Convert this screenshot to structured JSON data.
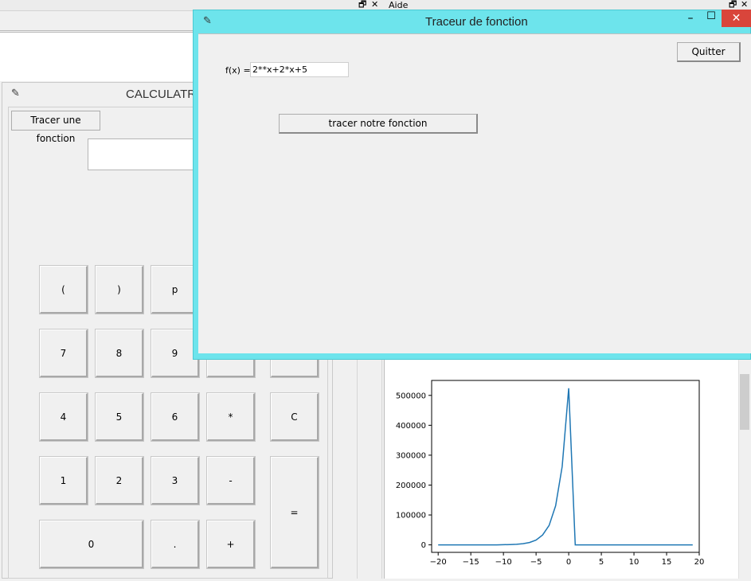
{
  "background_window": {
    "menu_label": "Aide",
    "restore_glyph": "🗗",
    "close_glyph": "✕"
  },
  "calculator": {
    "title": "CALCULATRI",
    "tracer_button": "Tracer une fonction",
    "display_value": "",
    "keys": {
      "open_paren": "(",
      "close_paren": ")",
      "p": "p",
      "seven": "7",
      "eight": "8",
      "nine": "9",
      "four": "4",
      "five": "5",
      "six": "6",
      "multiply": "*",
      "clear": "C",
      "one": "1",
      "two": "2",
      "three": "3",
      "minus": "-",
      "equals": "=",
      "zero": "0",
      "dot": ".",
      "plus": "+"
    }
  },
  "traceur": {
    "title": "Traceur de fonction",
    "minimize_glyph": "–",
    "maximize_glyph": "☐",
    "close_glyph": "✕",
    "quit_button": "Quitter",
    "fx_label": "f(x) =",
    "fx_value": "2**x+2*x+5",
    "plot_button": "tracer notre fonction"
  },
  "colors": {
    "traceur_border": "#6de4ec",
    "close_red": "#d9453b",
    "line_blue": "#1f77b4"
  },
  "chart_data": {
    "type": "line",
    "x": [
      -20,
      -19,
      -18,
      -17,
      -16,
      -15,
      -14,
      -13,
      -12,
      -11,
      -10,
      -9,
      -8,
      -7,
      -6,
      -5,
      -4,
      -3,
      -2,
      -1,
      0,
      1,
      2,
      3,
      4,
      5,
      6,
      7,
      8,
      9,
      10,
      11,
      12,
      13,
      14,
      15,
      16,
      17,
      18,
      19
    ],
    "y": [
      0,
      0,
      0,
      0,
      0,
      0,
      0,
      0,
      0,
      0,
      500,
      1000,
      2000,
      4000,
      8000,
      16000,
      33000,
      65000,
      131000,
      262000,
      524000,
      0,
      0,
      0,
      0,
      0,
      0,
      0,
      0,
      0,
      0,
      0,
      0,
      0,
      0,
      0,
      0,
      0,
      0,
      0
    ],
    "xlim": [
      -21,
      20
    ],
    "ylim": [
      -25000,
      550000
    ],
    "xticks": [
      -20,
      -15,
      -10,
      -5,
      0,
      5,
      10,
      15,
      20
    ],
    "xtick_labels": [
      "−20",
      "−15",
      "−10",
      "−5",
      "0",
      "5",
      "10",
      "15",
      "20"
    ],
    "yticks": [
      0,
      100000,
      200000,
      300000,
      400000,
      500000
    ],
    "ytick_labels": [
      "0",
      "100000",
      "200000",
      "300000",
      "400000",
      "500000"
    ],
    "grid": false
  }
}
